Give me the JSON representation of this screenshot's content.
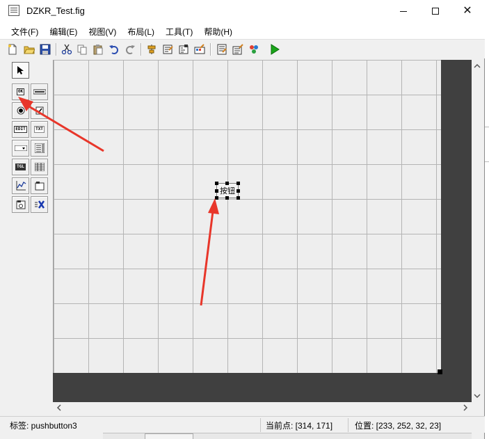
{
  "window": {
    "title": "DZKR_Test.fig",
    "minimize_label": "",
    "maximize_label": "",
    "close_label": "✕"
  },
  "menubar": {
    "items": [
      {
        "label": "文件(F)"
      },
      {
        "label": "编辑(E)"
      },
      {
        "label": "视图(V)"
      },
      {
        "label": "布局(L)"
      },
      {
        "label": "工具(T)"
      },
      {
        "label": "帮助(H)"
      }
    ]
  },
  "toolbar": {
    "icons": [
      "new-file-icon",
      "open-folder-icon",
      "save-icon",
      "cut-icon",
      "copy-icon",
      "paste-icon",
      "undo-icon",
      "redo-icon",
      "align-icon",
      "menu-editor-icon",
      "tab-order-icon",
      "toolbar-editor-icon",
      "mfile-editor-icon",
      "property-inspector-icon",
      "object-browser-icon",
      "run-icon"
    ]
  },
  "palette": {
    "tools": [
      {
        "name": "select-tool",
        "text": ""
      },
      {
        "name": "pushbutton-tool",
        "text": "OK"
      },
      {
        "name": "slider-tool",
        "text": ""
      },
      {
        "name": "radiobutton-tool",
        "text": ""
      },
      {
        "name": "checkbox-tool",
        "text": ""
      },
      {
        "name": "edit-text-tool",
        "text": "EDIT"
      },
      {
        "name": "static-text-tool",
        "text": "TXT"
      },
      {
        "name": "popup-menu-tool",
        "text": ""
      },
      {
        "name": "listbox-tool",
        "text": ""
      },
      {
        "name": "toggle-button-tool",
        "text": "TGL"
      },
      {
        "name": "table-tool",
        "text": ""
      },
      {
        "name": "axes-tool",
        "text": ""
      },
      {
        "name": "panel-tool",
        "text": ""
      },
      {
        "name": "button-group-tool",
        "text": ""
      },
      {
        "name": "activex-tool",
        "text": "X"
      }
    ]
  },
  "canvas": {
    "pushbutton_label": "按钮"
  },
  "status": {
    "tag": "标签: pushbutton3",
    "current_point": "当前点:  [314, 171]",
    "position": "位置: [233, 252, 32, 23]"
  },
  "colors": {
    "annotation_arrow": "#e8362a",
    "layout_background": "#404040",
    "grid_line": "#b4b4b4",
    "run_icon": "#1aa51a"
  }
}
